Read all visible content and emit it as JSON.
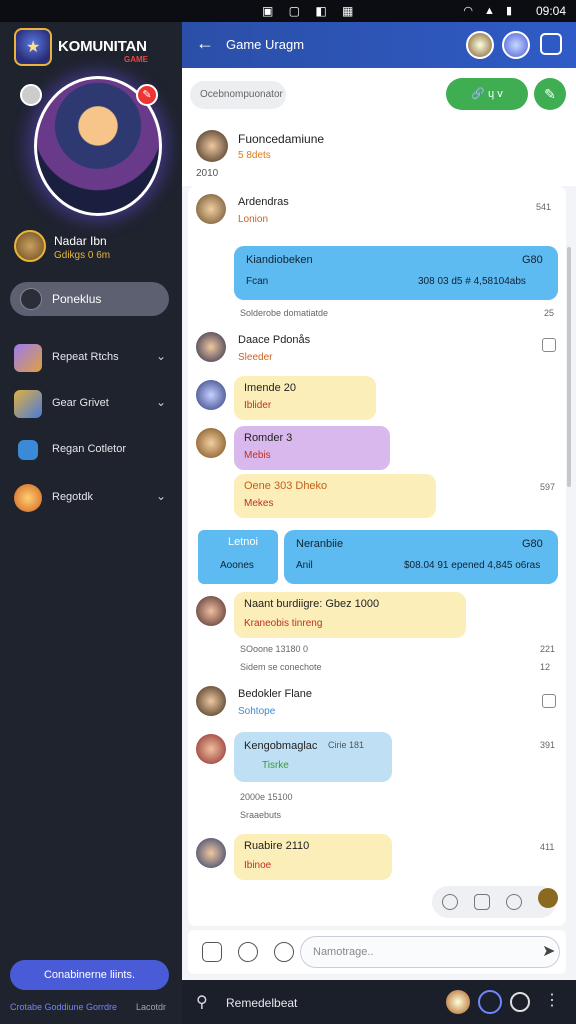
{
  "status_bar": {
    "time": "09:04",
    "signal_icons": "wifi-signal-battery",
    "notif_icons": "notifications"
  },
  "sidebar": {
    "logo_text": "KOMUNITAN",
    "logo_sub": "GAME",
    "player": {
      "name": "Nadar Ibn",
      "stats": "Gdikgs 0 6m"
    },
    "active_item": "Poneklus",
    "items": [
      {
        "label": "Repeat Rtchs",
        "icon": "swords-icon"
      },
      {
        "label": "Gear Grivet",
        "icon": "chest-icon"
      },
      {
        "label": "Regan Cotletor",
        "icon": "chat-icon"
      },
      {
        "label": "Regotdk",
        "icon": "trophy-icon"
      }
    ],
    "cta_label": "Conabinerne liints.",
    "footer_left": "Crotabe Goddiune Gorrdre",
    "footer_right": "Lacotdr"
  },
  "header": {
    "title": "Game Uragm"
  },
  "toolbar": {
    "search_placeholder": "Ocebnompuonator",
    "pill_label": "ɥ v"
  },
  "feed_head": {
    "name": "Fuoncedamiune",
    "meta": "5 8dets",
    "time": "2010"
  },
  "messages": [
    {
      "name": "Ardendras",
      "sub": "Lonion",
      "time": "541"
    },
    {
      "bubble_title": "Kiandiobeken",
      "bubble_num": "G80",
      "bubble_sub": "Fcan",
      "bubble_val": "308 03 d5 # 4,58104abs"
    },
    {
      "grey": "Solderobe domatiatde",
      "time": "25"
    },
    {
      "name": "Daace Pdonås",
      "sub": "Sleeder"
    },
    {
      "bubble_title": "Imende 20",
      "bubble_sub": "Iblider"
    },
    {
      "bubble_title": "Romder 3",
      "bubble_sub": "Mebis"
    },
    {
      "bubble_title": "Oene 303 Dheko",
      "bubble_sub": "Mekes",
      "time": "597"
    },
    {
      "left_title": "Letnoi",
      "left_sub": "Aoones",
      "bubble_title": "Neranbiie",
      "bubble_num": "G80",
      "bubble_sub": "Anil",
      "bubble_val": "$08.04 91 epened 4,845 o6ras"
    },
    {
      "bubble_title": "Naant burdiigre: Gbez 1000",
      "bubble_sub": "Kraneobis tinreng"
    },
    {
      "grey1": "SOoone 13180 0",
      "time1": "221",
      "grey2": "Sidem se conechote",
      "time2": "12"
    },
    {
      "name": "Bedokler Flane",
      "sub": "Sohtope"
    },
    {
      "bubble_title": "Kengobmaglac",
      "bubble_num": "Cirie 181",
      "bubble_sub": "Tisrke",
      "time": "391"
    },
    {
      "grey1": "2000e 15100",
      "grey2": "Sraaebuts"
    },
    {
      "bubble_title": "Ruabire 2110",
      "bubble_sub": "Ibinoe",
      "time": "411"
    }
  ],
  "composer": {
    "placeholder": "Namotrage.."
  },
  "bottom_bar": {
    "label": "Remedelbeat"
  }
}
